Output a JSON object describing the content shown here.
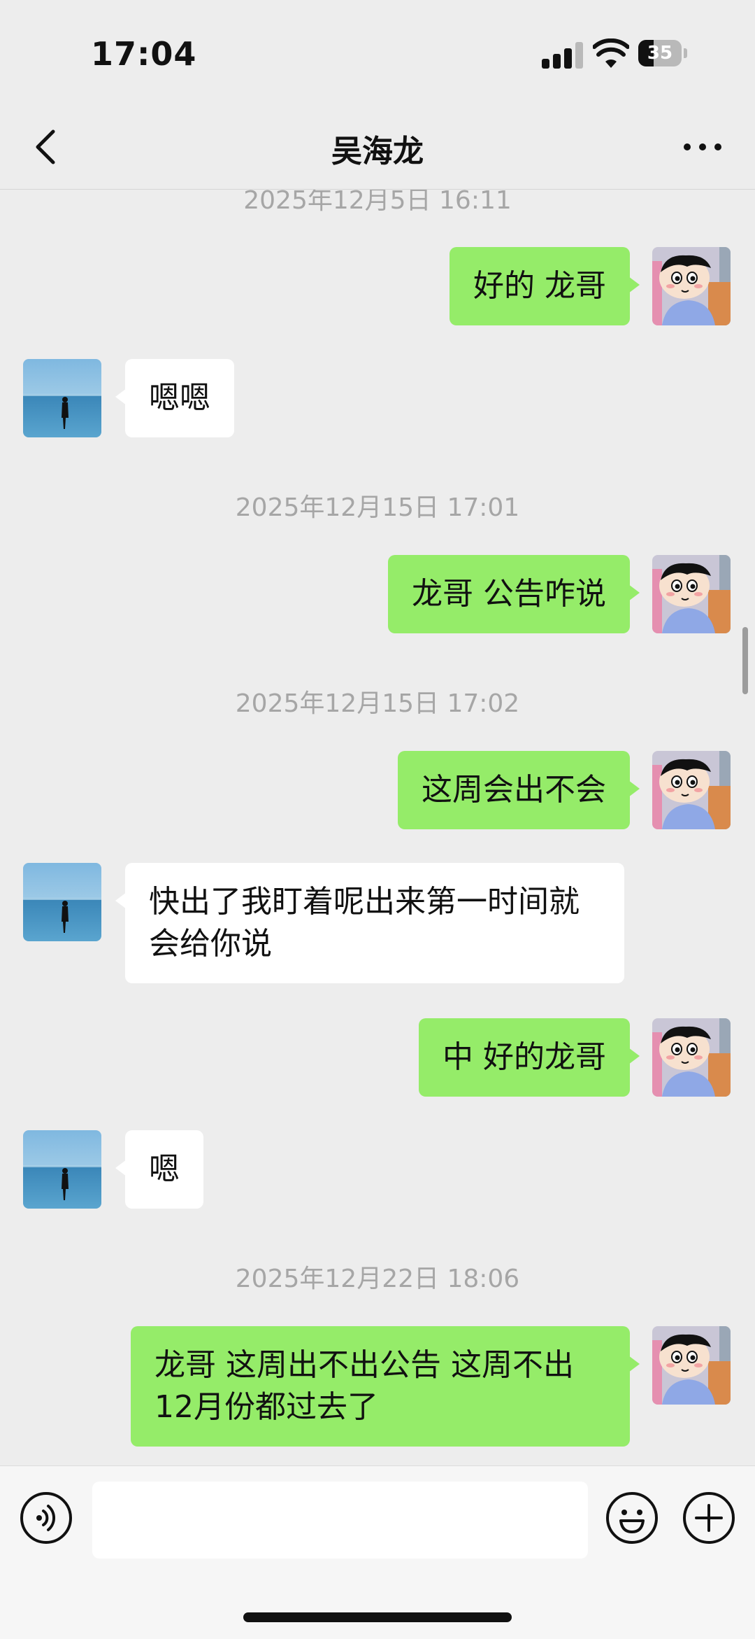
{
  "status": {
    "time": "17:04",
    "battery": "35",
    "battery_level": 0.35
  },
  "nav": {
    "title": "吴海龙"
  },
  "chat": {
    "timestamp_top": "2025年12月5日 16:11",
    "msg1": "好的 龙哥",
    "msg2": "嗯嗯",
    "ts2": "2025年12月15日 17:01",
    "msg3": "龙哥  公告咋说",
    "ts3": "2025年12月15日 17:02",
    "msg4": "这周会出不会",
    "msg5": "快出了我盯着呢出来第一时间就会给你说",
    "msg6": "中 好的龙哥",
    "msg7": "嗯",
    "ts4": "2025年12月22日 18:06",
    "msg8": "龙哥 这周出不出公告  这周不出12月份都过去了"
  },
  "input": {
    "placeholder": ""
  },
  "icons": {
    "back": "chevron-left-icon",
    "more": "more-dots-icon",
    "voice": "voice-icon",
    "emoji": "emoji-icon",
    "plus": "plus-icon"
  },
  "colors": {
    "outgoing_bubble": "#95ec69",
    "incoming_bubble": "#ffffff",
    "background": "#ededed"
  }
}
